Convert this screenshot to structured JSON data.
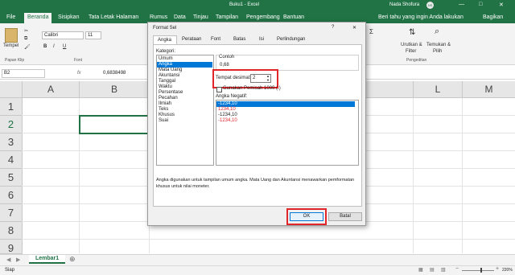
{
  "window": {
    "title": "Buku1 - Excel",
    "user_name": "Nada Shofura",
    "user_initials": "NS",
    "minimize": "—",
    "maximize": "□",
    "close": "✕"
  },
  "ribbon_tabs": [
    "File",
    "Beranda",
    "Sisipkan",
    "Tata Letak Halaman",
    "Rumus",
    "Data",
    "Tinjau",
    "Tampilan",
    "Pengembang",
    "Bantuan"
  ],
  "tell_me": "Beri tahu yang ingin Anda lakukan",
  "share": "Bagikan",
  "ribbon": {
    "paste_label": "Tempel",
    "clipboard_group": "Papan Klip",
    "font_name": "Calibri",
    "font_size": "11",
    "bold": "B",
    "italic": "I",
    "underline": "U",
    "font_group": "Font",
    "sort_filter_line1": "Urutkan &",
    "sort_filter_line2": "Filter",
    "find_select_line1": "Temukan &",
    "find_select_line2": "Pilih",
    "editing_group": "Pengeditan"
  },
  "formula_bar": {
    "name_box": "B2",
    "fx": "fx",
    "value": "0,6838498"
  },
  "grid": {
    "columns": [
      "A",
      "B",
      "C",
      "D",
      "E",
      "F",
      "G",
      "H",
      "I",
      "J",
      "K",
      "L",
      "M"
    ],
    "rows": [
      "1",
      "2",
      "3",
      "4",
      "5",
      "6",
      "7",
      "8",
      "9"
    ]
  },
  "sheet_tab": "Lembar1",
  "status": {
    "ready": "Siap",
    "zoom": "220%"
  },
  "dialog": {
    "title": "Format Sel",
    "help": "?",
    "close": "✕",
    "tabs": [
      "Angka",
      "Perataan",
      "Font",
      "Batas",
      "Isi",
      "Perlindungan"
    ],
    "category_label": "Kategori:",
    "categories": [
      "Umum",
      "Angka",
      "Mata Uang",
      "Akuntansi",
      "Tanggal",
      "Waktu",
      "Persentase",
      "Pecahan",
      "Ilmiah",
      "Teks",
      "Khusus",
      "Suai"
    ],
    "selected_category": "Angka",
    "sample_label": "Contoh",
    "sample_value": "0,68",
    "decimal_label": "Tempat desimal:",
    "decimal_value": "2",
    "separator_label": "Gunakan Pemisah 1000 (.)",
    "negative_label": "Angka Negatif:",
    "negative_options": [
      "-1234,10",
      "1234,10",
      "-1234,10",
      "-1234,10"
    ],
    "description": "Angka digunakan untuk tampilan umum angka. Mata Uang dan Akuntansi menawarkan pemformatan khusus untuk nilai moneter.",
    "ok": "OK",
    "cancel": "Batal"
  },
  "colors": {
    "excel_green": "#217346",
    "selection": "#0078d7",
    "highlight_red": "#e0262b",
    "negative_red": "#e0262b"
  }
}
